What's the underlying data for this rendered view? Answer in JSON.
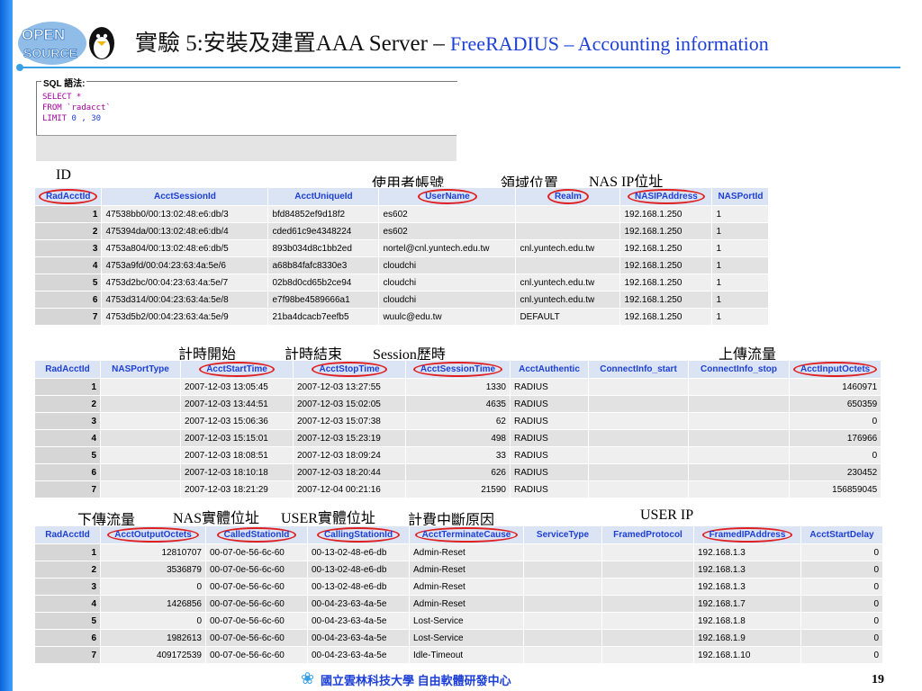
{
  "header": {
    "title_main": "實驗 5:安裝及建置AAA Server  – ",
    "title_sub": "FreeRADIUS – Accounting information",
    "logo_text": "OPEN SOURCE"
  },
  "sql": {
    "legend": "SQL 語法:",
    "line1": "SELECT *",
    "line2": "FROM `radacct`",
    "line3_kw": "LIMIT ",
    "line3_nums": "0 , 30"
  },
  "annotations": {
    "t1": [
      "ID",
      "使用者帳號",
      "領域位置",
      "NAS IP位址"
    ],
    "t2": [
      "計時開始",
      "計時結束",
      "Session歷時",
      "上傳流量"
    ],
    "t3": [
      "下傳流量",
      "NAS實體位址",
      "USER實體位址",
      "計費中斷原因",
      "USER IP"
    ]
  },
  "table1": {
    "headers": [
      "RadAcctId",
      "AcctSessionId",
      "AcctUniqueId",
      "UserName",
      "Realm",
      "NASIPAddress",
      "NASPortId"
    ],
    "rows": [
      [
        "1",
        "47538bb0/00:13:02:48:e6:db/3",
        "bfd84852ef9d18f2",
        "es602",
        "",
        "192.168.1.250",
        "1"
      ],
      [
        "2",
        "475394da/00:13:02:48:e6:db/4",
        "cded61c9e4348224",
        "es602",
        "",
        "192.168.1.250",
        "1"
      ],
      [
        "3",
        "4753a804/00:13:02:48:e6:db/5",
        "893b034d8c1bb2ed",
        "nortel@cnl.yuntech.edu.tw",
        "cnl.yuntech.edu.tw",
        "192.168.1.250",
        "1"
      ],
      [
        "4",
        "4753a9fd/00:04:23:63:4a:5e/6",
        "a68b84fafc8330e3",
        "cloudchi",
        "",
        "192.168.1.250",
        "1"
      ],
      [
        "5",
        "4753d2bc/00:04:23:63:4a:5e/7",
        "02b8d0cd65b2ce94",
        "cloudchi",
        "cnl.yuntech.edu.tw",
        "192.168.1.250",
        "1"
      ],
      [
        "6",
        "4753d314/00:04:23:63:4a:5e/8",
        "e7f98be4589666a1",
        "cloudchi",
        "cnl.yuntech.edu.tw",
        "192.168.1.250",
        "1"
      ],
      [
        "7",
        "4753d5b2/00:04:23:63:4a:5e/9",
        "21ba4dcacb7eefb5",
        "wuulc@edu.tw",
        "DEFAULT",
        "192.168.1.250",
        "1"
      ]
    ]
  },
  "table2": {
    "headers": [
      "RadAcctId",
      "NASPortType",
      "AcctStartTime",
      "AcctStopTime",
      "AcctSessionTime",
      "AcctAuthentic",
      "ConnectInfo_start",
      "ConnectInfo_stop",
      "AcctInputOctets"
    ],
    "rows": [
      [
        "1",
        "",
        "2007-12-03 13:05:45",
        "2007-12-03 13:27:55",
        "1330",
        "RADIUS",
        "",
        "",
        "1460971"
      ],
      [
        "2",
        "",
        "2007-12-03 13:44:51",
        "2007-12-03 15:02:05",
        "4635",
        "RADIUS",
        "",
        "",
        "650359"
      ],
      [
        "3",
        "",
        "2007-12-03 15:06:36",
        "2007-12-03 15:07:38",
        "62",
        "RADIUS",
        "",
        "",
        "0"
      ],
      [
        "4",
        "",
        "2007-12-03 15:15:01",
        "2007-12-03 15:23:19",
        "498",
        "RADIUS",
        "",
        "",
        "176966"
      ],
      [
        "5",
        "",
        "2007-12-03 18:08:51",
        "2007-12-03 18:09:24",
        "33",
        "RADIUS",
        "",
        "",
        "0"
      ],
      [
        "6",
        "",
        "2007-12-03 18:10:18",
        "2007-12-03 18:20:44",
        "626",
        "RADIUS",
        "",
        "",
        "230452"
      ],
      [
        "7",
        "",
        "2007-12-03 18:21:29",
        "2007-12-04 00:21:16",
        "21590",
        "RADIUS",
        "",
        "",
        "156859045"
      ]
    ]
  },
  "table3": {
    "headers": [
      "RadAcctId",
      "AcctOutputOctets",
      "CalledStationId",
      "CallingStationId",
      "AcctTerminateCause",
      "ServiceType",
      "FramedProtocol",
      "FramedIPAddress",
      "AcctStartDelay"
    ],
    "rows": [
      [
        "1",
        "12810707",
        "00-07-0e-56-6c-60",
        "00-13-02-48-e6-db",
        "Admin-Reset",
        "",
        "",
        "192.168.1.3",
        "0"
      ],
      [
        "2",
        "3536879",
        "00-07-0e-56-6c-60",
        "00-13-02-48-e6-db",
        "Admin-Reset",
        "",
        "",
        "192.168.1.3",
        "0"
      ],
      [
        "3",
        "0",
        "00-07-0e-56-6c-60",
        "00-13-02-48-e6-db",
        "Admin-Reset",
        "",
        "",
        "192.168.1.3",
        "0"
      ],
      [
        "4",
        "1426856",
        "00-07-0e-56-6c-60",
        "00-04-23-63-4a-5e",
        "Admin-Reset",
        "",
        "",
        "192.168.1.7",
        "0"
      ],
      [
        "5",
        "0",
        "00-07-0e-56-6c-60",
        "00-04-23-63-4a-5e",
        "Lost-Service",
        "",
        "",
        "192.168.1.8",
        "0"
      ],
      [
        "6",
        "1982613",
        "00-07-0e-56-6c-60",
        "00-04-23-63-4a-5e",
        "Lost-Service",
        "",
        "",
        "192.168.1.9",
        "0"
      ],
      [
        "7",
        "409172539",
        "00-07-0e-56-6c-60",
        "00-04-23-63-4a-5e",
        "Idle-Timeout",
        "",
        "",
        "192.168.1.10",
        "0"
      ]
    ]
  },
  "footer": {
    "org": "國立雲林科技大學 自由軟體研發中心",
    "page": "19"
  }
}
